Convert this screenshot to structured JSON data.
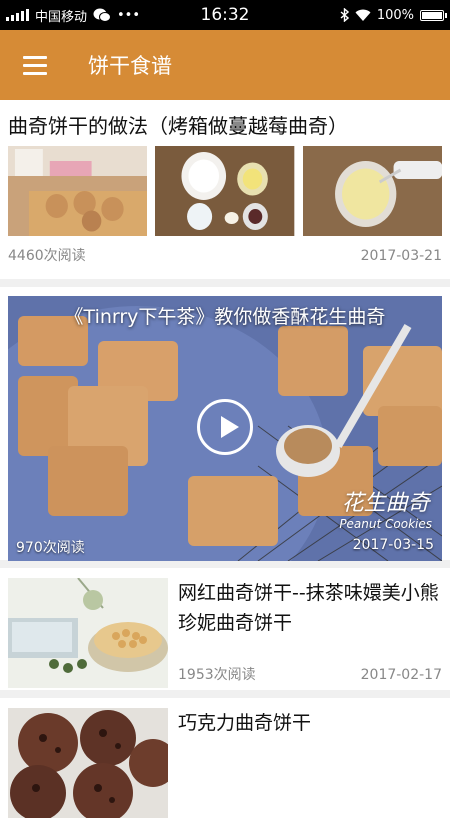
{
  "status_bar": {
    "carrier": "中国移动",
    "time": "16:32",
    "battery": "100%",
    "icons": [
      "signal-icon",
      "wechat-icon",
      "more-icon",
      "bluetooth-icon",
      "wifi-icon",
      "battery-icon"
    ]
  },
  "app_bar": {
    "menu_icon": "menu-icon",
    "title": "饼干食谱"
  },
  "colors": {
    "accent": "#d68b36",
    "divider": "#f0f0f0",
    "meta_text": "#888888"
  },
  "articles": [
    {
      "title": "曲奇饼干的做法（烤箱做蔓越莓曲奇）",
      "reads": "4460次阅读",
      "date": "2017-03-21",
      "layout": "three-images"
    },
    {
      "title": "《Tinrry下午茶》教你做香酥花生曲奇",
      "reads": "970次阅读",
      "date": "2017-03-15",
      "layout": "video",
      "watermark": "花生曲奇",
      "watermark_sub": "Peanut Cookies"
    },
    {
      "title": "网红曲奇饼干--抹茶味嬛美小熊珍妮曲奇饼干",
      "reads": "1953次阅读",
      "date": "2017-02-17",
      "layout": "side-image"
    },
    {
      "title": "巧克力曲奇饼干",
      "layout": "side-image"
    }
  ]
}
